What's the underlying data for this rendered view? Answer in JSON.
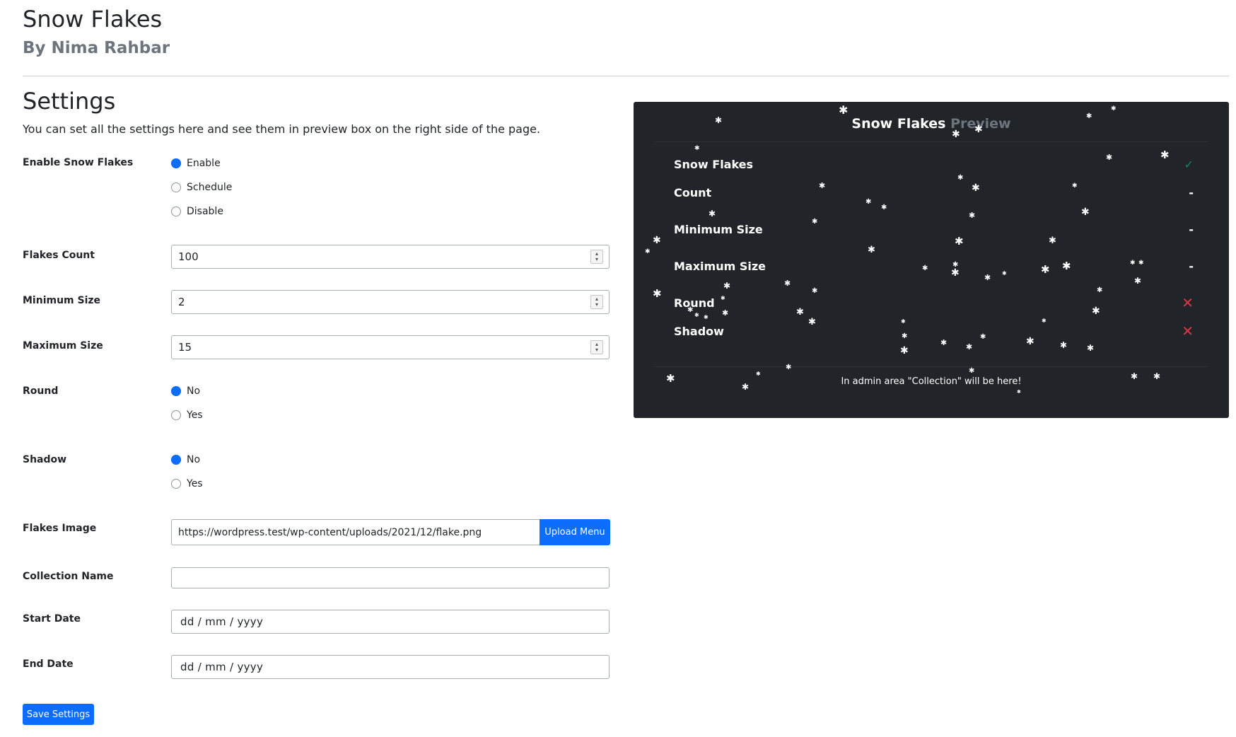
{
  "header": {
    "title": "Snow Flakes",
    "author_prefix": "By ",
    "author_name": "Nima Rahbar"
  },
  "settings": {
    "title": "Settings",
    "description": "You can set all the settings here and see them in preview box on the right side of the page.",
    "enable": {
      "label": "Enable Snow Flakes",
      "options": [
        "Enable",
        "Schedule",
        "Disable"
      ],
      "selected": "Enable"
    },
    "count": {
      "label": "Flakes Count",
      "value": "100"
    },
    "min_size": {
      "label": "Minimum Size",
      "value": "2"
    },
    "max_size": {
      "label": "Maximum Size",
      "value": "15"
    },
    "round": {
      "label": "Round",
      "options": [
        "No",
        "Yes"
      ],
      "selected": "No"
    },
    "shadow": {
      "label": "Shadow",
      "options": [
        "No",
        "Yes"
      ],
      "selected": "No"
    },
    "image": {
      "label": "Flakes Image",
      "value": "https://wordpress.test/wp-content/uploads/2021/12/flake.png",
      "upload_label": "Upload Menu"
    },
    "collection": {
      "label": "Collection Name",
      "value": ""
    },
    "start_date": {
      "label": "Start Date",
      "placeholder": "dd / mm / yyyy"
    },
    "end_date": {
      "label": "End Date",
      "placeholder": "dd / mm / yyyy"
    },
    "save_label": "Save Settings"
  },
  "preview": {
    "title_main": "Snow Flakes ",
    "title_muted": "Preview",
    "rows": [
      {
        "label": "Snow Flakes",
        "value": "✓"
      },
      {
        "label": "Count",
        "value": "-"
      },
      {
        "label": "Minimum Size",
        "value": "-"
      },
      {
        "label": "Maximum Size",
        "value": "-"
      },
      {
        "label": "Round",
        "value": "✕"
      },
      {
        "label": "Shadow",
        "value": "✕"
      }
    ],
    "footer": "In admin area \"Collection\" will be here!"
  },
  "colors": {
    "primary": "#0d6efd",
    "preview_bg": "#212529",
    "check": "#198754",
    "cross": "#dc3545",
    "muted": "#6c757d"
  }
}
